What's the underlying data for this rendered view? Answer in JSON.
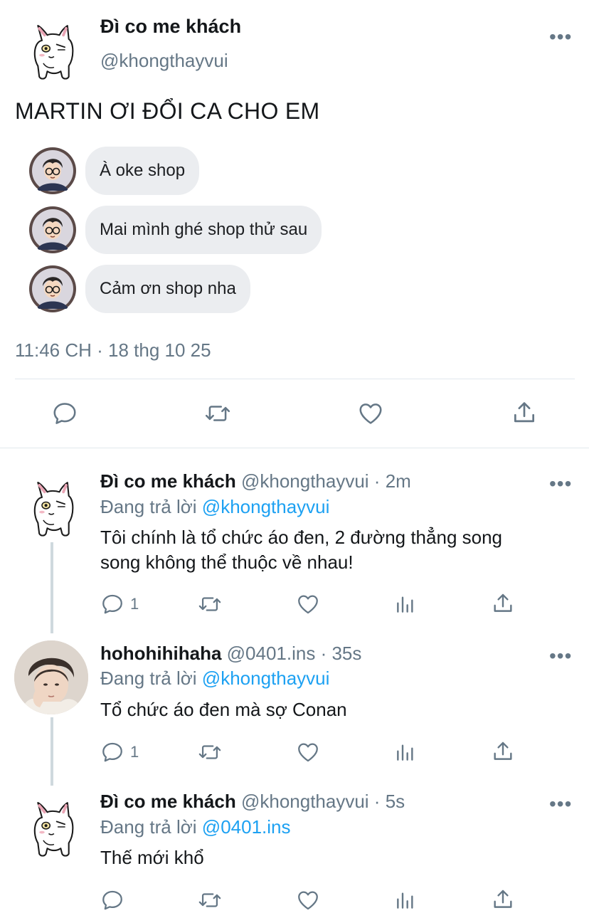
{
  "tweet": {
    "author_name": "Đì co me khách",
    "author_handle": "@khongthayvui",
    "more_label": "•••",
    "text": "MARTIN ƠI ĐỔI CA CHO EM",
    "chat": [
      {
        "message": "À oke shop"
      },
      {
        "message": "Mai mình ghé shop thử sau"
      },
      {
        "message": "Cảm ơn shop nha"
      }
    ],
    "timestamp": "11:46 CH · 18 thg 10 25",
    "actions": [
      "reply-icon",
      "retweet-icon",
      "like-icon",
      "share-icon"
    ]
  },
  "replies": [
    {
      "name": "Đì co me khách",
      "handle_time": "@khongthayvui · 2m",
      "replying_prefix": "Đang trả lời",
      "replying_to": "@khongthayvui",
      "text_lines": [
        "Tôi chính là tổ chức áo đen, 2 đường thẳng song",
        "song không thể thuộc về nhau!"
      ],
      "reply_count": "1",
      "more_label": "•••"
    },
    {
      "name": "hohohihihaha",
      "handle_time": "@0401.ins · 35s",
      "replying_prefix": "Đang trả lời",
      "replying_to": "@khongthayvui",
      "text_lines": [
        "Tổ chức áo đen mà sợ Conan"
      ],
      "reply_count": "1",
      "more_label": "•••"
    },
    {
      "name": "Đì co me khách",
      "handle_time": "@khongthayvui · 5s",
      "replying_prefix": "Đang trả lời",
      "replying_to": "@0401.ins",
      "text_lines": [
        "Thế mới khổ"
      ],
      "reply_count": "",
      "more_label": "•••"
    }
  ],
  "colors": {
    "accent": "#1da1f2",
    "muted": "#657786",
    "bubble": "#ebedf0"
  }
}
